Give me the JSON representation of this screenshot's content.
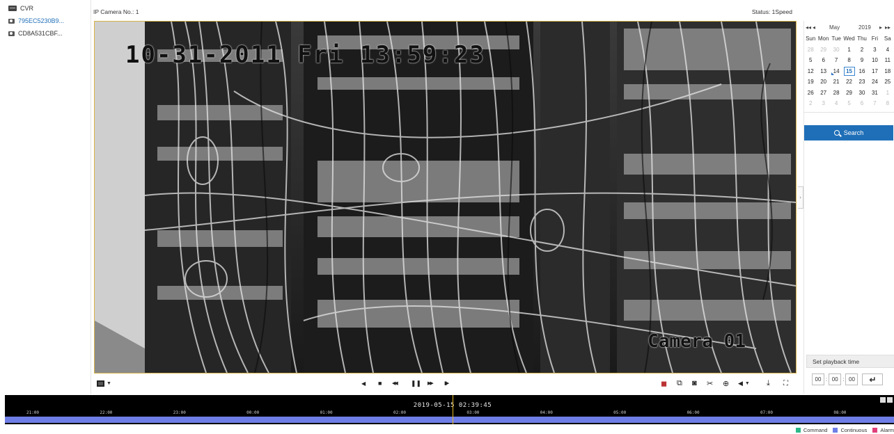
{
  "sidebar": {
    "root_label": "CVR",
    "cameras": [
      {
        "label": "795EC5230B9..."
      },
      {
        "label": "CD8A531CBF..."
      }
    ]
  },
  "header": {
    "camera_no": "IP Camera No.: 1",
    "status": "Status: 1Speed"
  },
  "video": {
    "osd_timestamp": "10-31-2011 Fri 13:59:23",
    "osd_camera": "Camera 01"
  },
  "controls": {
    "left": [
      {
        "icon": "layout-icon"
      }
    ],
    "center": [
      {
        "icon": "reverse-play-icon",
        "glyph": "◀"
      },
      {
        "icon": "stop-icon",
        "glyph": "■"
      },
      {
        "icon": "slow-down-icon",
        "glyph": "◀◀"
      },
      {
        "icon": "pause-icon",
        "glyph": "❚❚"
      },
      {
        "icon": "fast-forward-icon",
        "glyph": "▶▶"
      },
      {
        "icon": "step-forward-icon",
        "glyph": "▮▶"
      }
    ],
    "right": [
      {
        "icon": "stop-all-icon",
        "glyph": "◼"
      },
      {
        "icon": "capture-all-icon",
        "glyph": "⧉"
      },
      {
        "icon": "camera-snapshot-icon",
        "glyph": "◙"
      },
      {
        "icon": "clip-icon",
        "glyph": "✂"
      },
      {
        "icon": "zoom-icon",
        "glyph": "⊕"
      },
      {
        "icon": "volume-icon",
        "glyph": "◀"
      },
      {
        "icon": "download-icon",
        "glyph": "⤓"
      },
      {
        "icon": "fullscreen-icon",
        "glyph": "⛶"
      }
    ]
  },
  "calendar": {
    "prev_year": "◂◂",
    "prev_month": "◂",
    "month": "May",
    "year": "2019",
    "next_month": "▸",
    "next_year": "▸▸",
    "weekdays": [
      "Sun",
      "Mon",
      "Tue",
      "Wed",
      "Thu",
      "Fri",
      "Sa"
    ],
    "weeks": [
      [
        {
          "d": "28",
          "m": true
        },
        {
          "d": "29",
          "m": true
        },
        {
          "d": "30",
          "m": true
        },
        {
          "d": "1"
        },
        {
          "d": "2"
        },
        {
          "d": "3"
        },
        {
          "d": "4"
        }
      ],
      [
        {
          "d": "5"
        },
        {
          "d": "6"
        },
        {
          "d": "7"
        },
        {
          "d": "8"
        },
        {
          "d": "9"
        },
        {
          "d": "10"
        },
        {
          "d": "11"
        }
      ],
      [
        {
          "d": "12"
        },
        {
          "d": "13"
        },
        {
          "d": "14",
          "rec": true
        },
        {
          "d": "15",
          "today": true
        },
        {
          "d": "16"
        },
        {
          "d": "17"
        },
        {
          "d": "18"
        }
      ],
      [
        {
          "d": "19"
        },
        {
          "d": "20"
        },
        {
          "d": "21"
        },
        {
          "d": "22"
        },
        {
          "d": "23"
        },
        {
          "d": "24"
        },
        {
          "d": "25"
        }
      ],
      [
        {
          "d": "26"
        },
        {
          "d": "27"
        },
        {
          "d": "28"
        },
        {
          "d": "29"
        },
        {
          "d": "30"
        },
        {
          "d": "31"
        },
        {
          "d": "1",
          "m": true
        }
      ],
      [
        {
          "d": "2",
          "m": true
        },
        {
          "d": "3",
          "m": true
        },
        {
          "d": "4",
          "m": true
        },
        {
          "d": "5",
          "m": true
        },
        {
          "d": "6",
          "m": true
        },
        {
          "d": "7",
          "m": true
        },
        {
          "d": "8",
          "m": true
        }
      ]
    ]
  },
  "search": {
    "label": "Search"
  },
  "playback_time": {
    "title": "Set playback time",
    "hh": "00",
    "mm": "00",
    "ss": "00",
    "go_glyph": "↵"
  },
  "timeline": {
    "current": "2019-05-15 02:39:45",
    "hours": [
      "21:00",
      "22:00",
      "23:00",
      "00:00",
      "01:00",
      "02:00",
      "03:00",
      "04:00",
      "05:00",
      "06:00",
      "07:00",
      "08:00"
    ]
  },
  "legend": [
    {
      "label": "Command",
      "color": "#2bb98a"
    },
    {
      "label": "Continuous",
      "color": "#6f7ee6"
    },
    {
      "label": "Alarm",
      "color": "#e0407a"
    }
  ],
  "colors": {
    "accent": "#1f6fb8",
    "video_border": "#d8b24a",
    "timeline_cursor": "#e8b820"
  }
}
